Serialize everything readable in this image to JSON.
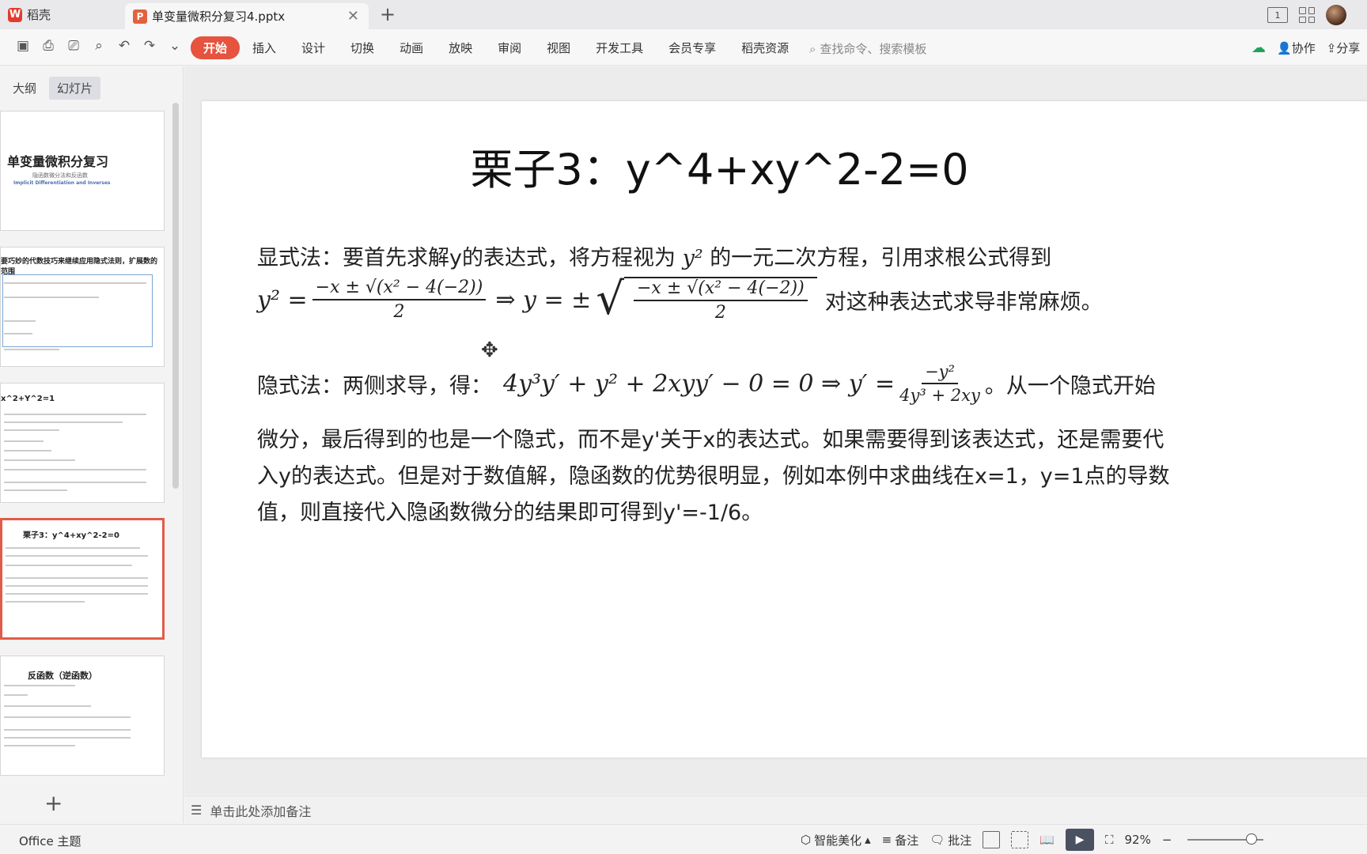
{
  "titlebar": {
    "home_tab": "稻壳",
    "doc_tab": "单变量微积分复习4.pptx",
    "close_glyph": "✕",
    "new_tab_glyph": "+"
  },
  "ribbon": {
    "menu": [
      "开始",
      "插入",
      "设计",
      "切换",
      "动画",
      "放映",
      "审阅",
      "视图",
      "开发工具",
      "会员专享",
      "稻壳资源"
    ],
    "active_menu": "开始",
    "search_placeholder": "查找命令、搜索模板",
    "collab_label": "协作",
    "share_label": "分享"
  },
  "left_panel": {
    "tabs": [
      "大纲",
      "幻灯片"
    ],
    "active_tab": "幻灯片",
    "thumbnails": [
      {
        "title": "单变量微积分复习",
        "subtitle": "隐函数微分法和反函数",
        "subtitle2": "Implicit Differentiation and Inverses"
      },
      {
        "title": "要巧妙的代数技巧来继续应用隐式法则，扩展数的范围"
      },
      {
        "title": "x^2+Y^2=1"
      },
      {
        "title": "栗子3：y^4+xy^2-2=0"
      },
      {
        "title": "反函数（逆函数）"
      }
    ],
    "active_index": 3
  },
  "slide": {
    "title": "栗子3：y^4+xy^2-2=0",
    "explicit_intro": "显式法：要首先求解y的表达式，将方程视为",
    "explicit_intro_2": "的一元二次方程，引用求根公式得到",
    "explicit_after": "对这种表达式求导非常麻烦。",
    "implicit_intro": "隐式法：两侧求导，得：",
    "implicit_after": "。从一个隐式开始",
    "body_line2": "微分，最后得到的也是一个隐式，而不是y'关于x的表达式。如果需要得到该表达式，还是需要代",
    "body_line3": "入y的表达式。但是对于数值解，隐函数的优势很明显，例如本例中求曲线在x=1，y=1点的导数",
    "body_line4": "值，则直接代入隐函数微分的结果即可得到y'=-1/6。",
    "math": {
      "y2": "y²",
      "lhs": "y² =",
      "num": "−x ± √(x² − 4(−2))",
      "den": "2",
      "implies": "⇒ y = ±",
      "deriv": "4y³y′ + y² + 2xyy′ − 0 = 0 ⇒ y′ =",
      "deriv_num": "−y²",
      "deriv_den": "4y³ + 2xy"
    }
  },
  "notes": {
    "placeholder": "单击此处添加备注"
  },
  "status": {
    "theme": "Office 主题",
    "beautify": "智能美化",
    "notes_btn": "备注",
    "comment_btn": "批注",
    "zoom": "92%"
  }
}
